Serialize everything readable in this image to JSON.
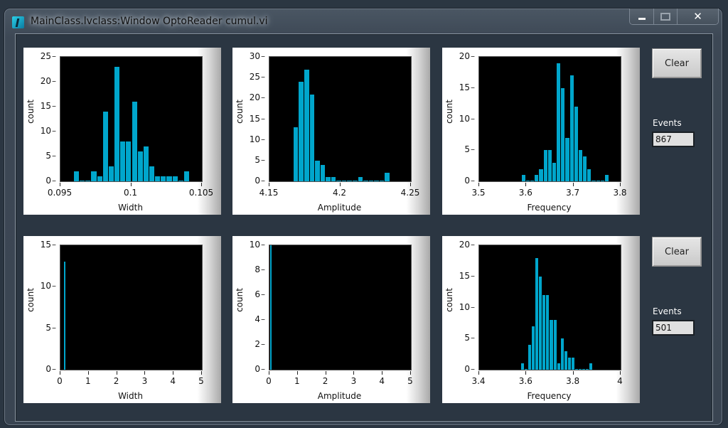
{
  "window": {
    "title": "MainClass.lvclass:Window OptoReader cumul.vi",
    "controls": {
      "minimize": "minimize",
      "maximize": "maximize",
      "close": "✕"
    }
  },
  "rows": [
    {
      "clear_label": "Clear",
      "events_label": "Events",
      "events_value": "867"
    },
    {
      "clear_label": "Clear",
      "events_label": "Events",
      "events_value": "501"
    }
  ],
  "bar_color": "#00a6cc",
  "chart_data": [
    {
      "id": "top-width",
      "type": "bar",
      "xlabel": "Width",
      "ylabel": "count",
      "xlim": [
        0.095,
        0.105
      ],
      "ylim": [
        0,
        25
      ],
      "xticks": [
        "0.095",
        "0.1",
        "0.105"
      ],
      "xtick_values": [
        0.095,
        0.1,
        0.105
      ],
      "yticks": [
        "0",
        "5",
        "10",
        "15",
        "20",
        "25"
      ],
      "ytick_values": [
        0,
        5,
        10,
        15,
        20,
        25
      ],
      "bin_start": 0.0959,
      "bin_width": 0.00041,
      "values": [
        2,
        0,
        0,
        2,
        1,
        14,
        3,
        23,
        8,
        8,
        16,
        6,
        7,
        3,
        1,
        1,
        1,
        1,
        0,
        2
      ]
    },
    {
      "id": "top-amplitude",
      "type": "bar",
      "xlabel": "Amplitude",
      "ylabel": "count",
      "xlim": [
        4.15,
        4.25
      ],
      "ylim": [
        0,
        30
      ],
      "xticks": [
        "4.15",
        "4.2",
        "4.25"
      ],
      "xtick_values": [
        4.15,
        4.2,
        4.25
      ],
      "yticks": [
        "0",
        "5",
        "10",
        "15",
        "20",
        "25",
        "30"
      ],
      "ytick_values": [
        0,
        5,
        10,
        15,
        20,
        25,
        30
      ],
      "bin_start": 4.1665,
      "bin_width": 0.0038,
      "values": [
        13,
        24,
        27,
        21,
        5,
        4,
        1,
        1,
        0,
        0,
        0,
        0,
        1,
        0,
        0,
        0,
        0,
        2
      ]
    },
    {
      "id": "top-frequency",
      "type": "bar",
      "xlabel": "Frequency",
      "ylabel": "count",
      "xlim": [
        3.5,
        3.8
      ],
      "ylim": [
        0,
        20
      ],
      "xticks": [
        "3.5",
        "3.6",
        "3.7",
        "3.8"
      ],
      "xtick_values": [
        3.5,
        3.6,
        3.7,
        3.8
      ],
      "yticks": [
        "0",
        "5",
        "10",
        "15",
        "20"
      ],
      "ytick_values": [
        0,
        5,
        10,
        15,
        20
      ],
      "bin_start": 3.5885,
      "bin_width": 0.0093,
      "values": [
        1,
        0,
        0,
        1,
        2,
        5,
        5,
        3,
        19,
        15,
        7,
        17,
        12,
        5,
        4,
        2,
        0,
        0,
        0,
        1
      ]
    },
    {
      "id": "bottom-width",
      "type": "bar",
      "xlabel": "Width",
      "ylabel": "count",
      "xlim": [
        0,
        5
      ],
      "ylim": [
        0,
        15
      ],
      "xticks": [
        "0",
        "1",
        "2",
        "3",
        "4",
        "5"
      ],
      "xtick_values": [
        0,
        1,
        2,
        3,
        4,
        5
      ],
      "yticks": [
        "0",
        "5",
        "10",
        "15"
      ],
      "ytick_values": [
        0,
        5,
        10,
        15
      ],
      "bin_start": 0.09,
      "bin_width": 0.08,
      "values": [
        13
      ]
    },
    {
      "id": "bottom-amplitude",
      "type": "bar",
      "xlabel": "Amplitude",
      "ylabel": "count",
      "xlim": [
        0,
        5
      ],
      "ylim": [
        0,
        10
      ],
      "xticks": [
        "0",
        "1",
        "2",
        "3",
        "4",
        "5"
      ],
      "xtick_values": [
        0,
        1,
        2,
        3,
        4,
        5
      ],
      "yticks": [
        "0",
        "2",
        "4",
        "6",
        "8",
        "10"
      ],
      "ytick_values": [
        0,
        2,
        4,
        6,
        8,
        10
      ],
      "bin_start": 0.0,
      "bin_width": 0.08,
      "values": [
        10
      ]
    },
    {
      "id": "bottom-frequency",
      "type": "bar",
      "xlabel": "Frequency",
      "ylabel": "count",
      "xlim": [
        3.4,
        4.0
      ],
      "ylim": [
        0,
        20
      ],
      "xticks": [
        "3.4",
        "3.6",
        "3.8",
        "4"
      ],
      "xtick_values": [
        3.4,
        3.6,
        3.8,
        4.0
      ],
      "yticks": [
        "0",
        "5",
        "10",
        "15",
        "20"
      ],
      "ytick_values": [
        0,
        5,
        10,
        15,
        20
      ],
      "bin_start": 3.5745,
      "bin_width": 0.0153,
      "values": [
        1,
        0,
        4,
        7,
        18,
        15,
        12,
        12,
        8,
        8,
        1,
        5,
        3,
        2,
        2,
        0,
        0,
        0,
        0,
        1
      ]
    }
  ]
}
